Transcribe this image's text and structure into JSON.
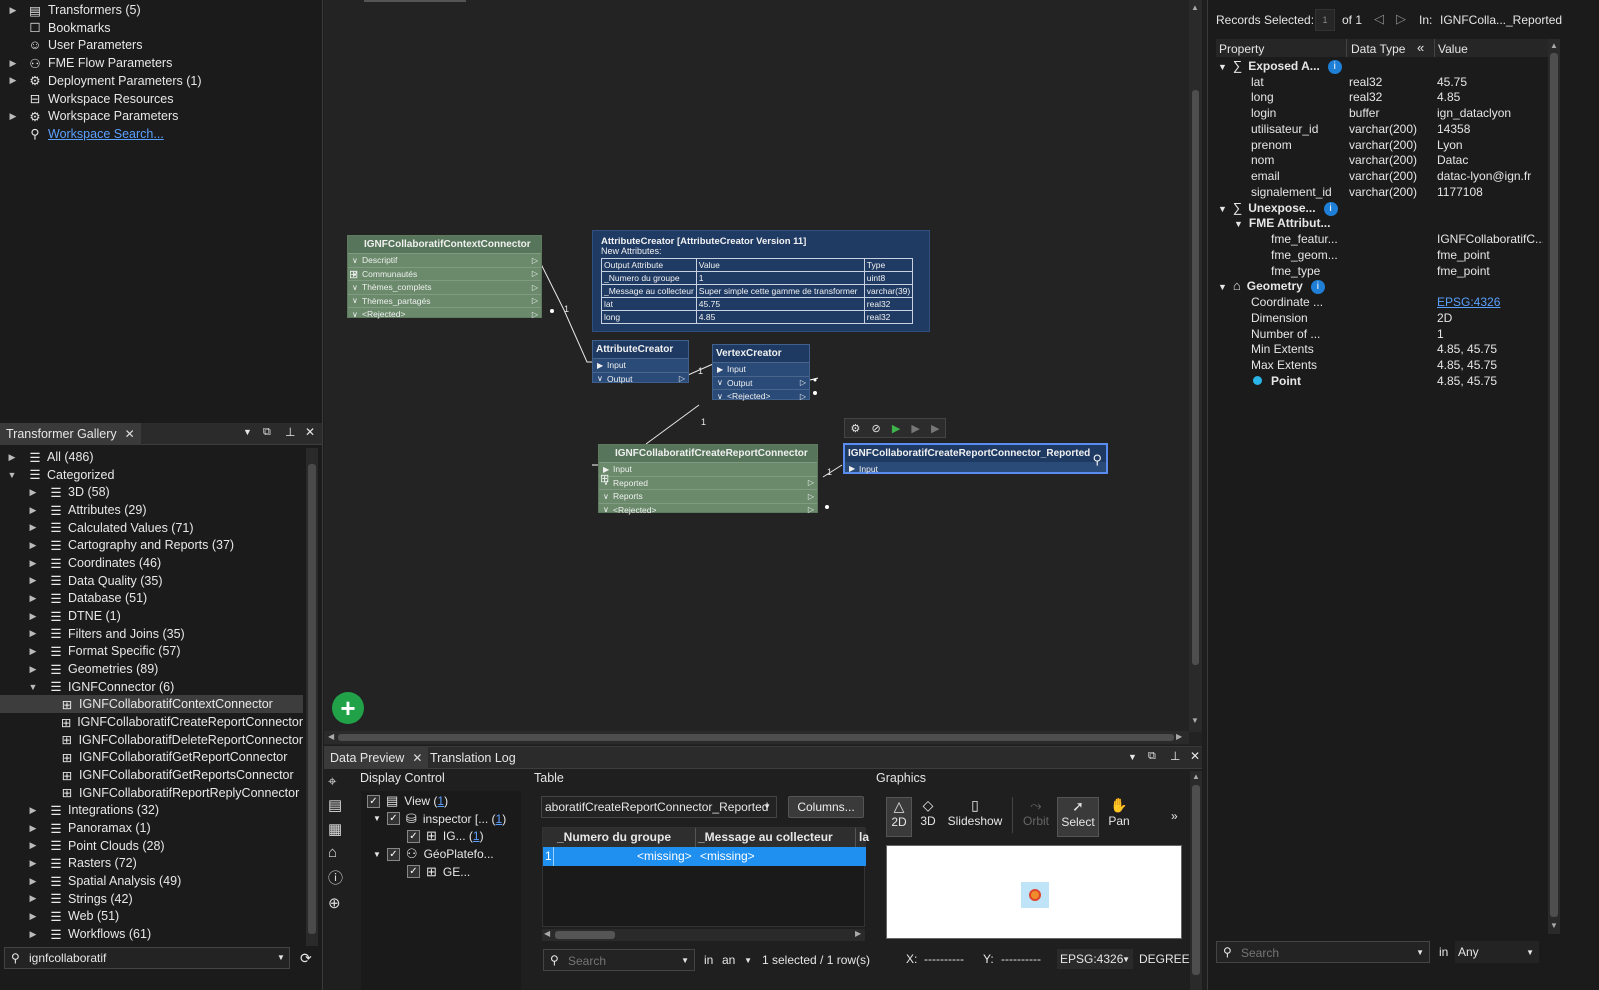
{
  "navigator": {
    "items": [
      {
        "label": "Transformers (5)",
        "expandable": true
      },
      {
        "label": "Bookmarks",
        "expandable": false
      },
      {
        "label": "User Parameters",
        "expandable": false
      },
      {
        "label": "FME Flow Parameters",
        "expandable": true
      },
      {
        "label": "Deployment Parameters (1)",
        "expandable": true
      },
      {
        "label": "Workspace Resources",
        "expandable": false
      },
      {
        "label": "Workspace Parameters",
        "expandable": true
      },
      {
        "label": "Workspace Search...",
        "expandable": false,
        "link": true
      }
    ]
  },
  "gallery": {
    "tab_label": "Transformer Gallery",
    "items": [
      {
        "label": "All (486)",
        "level": 0,
        "state": "collapsed"
      },
      {
        "label": "Categorized",
        "level": 0,
        "state": "expanded"
      },
      {
        "label": "3D (58)",
        "level": 1,
        "state": "collapsed"
      },
      {
        "label": "Attributes (29)",
        "level": 1,
        "state": "collapsed"
      },
      {
        "label": "Calculated Values (71)",
        "level": 1,
        "state": "collapsed"
      },
      {
        "label": "Cartography and Reports (37)",
        "level": 1,
        "state": "collapsed"
      },
      {
        "label": "Coordinates (46)",
        "level": 1,
        "state": "collapsed"
      },
      {
        "label": "Data Quality (35)",
        "level": 1,
        "state": "collapsed"
      },
      {
        "label": "Database (51)",
        "level": 1,
        "state": "collapsed"
      },
      {
        "label": "DTNE (1)",
        "level": 1,
        "state": "collapsed"
      },
      {
        "label": "Filters and Joins (35)",
        "level": 1,
        "state": "collapsed"
      },
      {
        "label": "Format Specific (57)",
        "level": 1,
        "state": "collapsed"
      },
      {
        "label": "Geometries (89)",
        "level": 1,
        "state": "collapsed"
      },
      {
        "label": "IGNFConnector (6)",
        "level": 1,
        "state": "expanded"
      },
      {
        "label": "IGNFCollaboratifContextConnector",
        "level": 2,
        "state": "leaf",
        "selected": true
      },
      {
        "label": "IGNFCollaboratifCreateReportConnector",
        "level": 2,
        "state": "leaf"
      },
      {
        "label": "IGNFCollaboratifDeleteReportConnector",
        "level": 2,
        "state": "leaf"
      },
      {
        "label": "IGNFCollaboratifGetReportConnector",
        "level": 2,
        "state": "leaf"
      },
      {
        "label": "IGNFCollaboratifGetReportsConnector",
        "level": 2,
        "state": "leaf"
      },
      {
        "label": "IGNFCollaboratifReportReplyConnector",
        "level": 2,
        "state": "leaf"
      },
      {
        "label": "Integrations (32)",
        "level": 1,
        "state": "collapsed"
      },
      {
        "label": "Panoramax (1)",
        "level": 1,
        "state": "collapsed"
      },
      {
        "label": "Point Clouds (28)",
        "level": 1,
        "state": "collapsed"
      },
      {
        "label": "Rasters (72)",
        "level": 1,
        "state": "collapsed"
      },
      {
        "label": "Spatial Analysis (49)",
        "level": 1,
        "state": "collapsed"
      },
      {
        "label": "Strings (42)",
        "level": 1,
        "state": "collapsed"
      },
      {
        "label": "Web (51)",
        "level": 1,
        "state": "collapsed"
      },
      {
        "label": "Workflows (61)",
        "level": 1,
        "state": "collapsed"
      }
    ],
    "search_value": "ignfcollaboratif"
  },
  "canvas": {
    "context_node": {
      "title": "IGNFCollaboratifContextConnector",
      "ports": [
        "Descriptif",
        "Communautés",
        "Thèmes_complets",
        "Thèmes_partagés",
        "<Rejected>"
      ]
    },
    "annotation": {
      "title": "AttributeCreator [AttributeCreator Version 11]",
      "subtitle": "New Attributes:",
      "headers": [
        "Output Attribute",
        "Value",
        "Type"
      ],
      "rows": [
        [
          "_Numero du groupe",
          "1",
          "uint8"
        ],
        [
          "_Message au collecteur",
          "Super simple cette gamme de transformer",
          "varchar(39)"
        ],
        [
          "lat",
          "45.75",
          "real32"
        ],
        [
          "long",
          "4.85",
          "real32"
        ]
      ]
    },
    "attribute_creator": {
      "title": "AttributeCreator",
      "ports": [
        "Input",
        "Output"
      ]
    },
    "vertex_creator": {
      "title": "VertexCreator",
      "ports": [
        "Input",
        "Output",
        "<Rejected>"
      ]
    },
    "create_report": {
      "title": "IGNFCollaboratifCreateReportConnector",
      "ports": [
        "Input",
        "Reported",
        "Reports",
        "<Rejected>"
      ]
    },
    "inspector_node": {
      "title": "IGNFCollaboratifCreateReportConnector_Reported",
      "ports": [
        "Input"
      ]
    },
    "link_counts": [
      "1",
      "1",
      "1",
      "1"
    ]
  },
  "inspector": {
    "records_label": "Records Selected:",
    "records_value": "1",
    "records_of": "of 1",
    "in_label": "In:",
    "in_value": "IGNFColla..._Reported",
    "columns": [
      "Property",
      "Data Type",
      "Value"
    ],
    "rows": [
      {
        "indent": 0,
        "group": true,
        "name": "Exposed A...",
        "type": "",
        "value": "",
        "info": true,
        "icon": "sigma"
      },
      {
        "indent": 1,
        "name": "lat",
        "type": "real32",
        "value": "45.75"
      },
      {
        "indent": 1,
        "name": "long",
        "type": "real32",
        "value": "4.85"
      },
      {
        "indent": 1,
        "name": "login",
        "type": "buffer",
        "value": "ign_dataclyon"
      },
      {
        "indent": 1,
        "name": "utilisateur_id",
        "type": "varchar(200)",
        "value": "14358"
      },
      {
        "indent": 1,
        "name": "prenom",
        "type": "varchar(200)",
        "value": "Lyon"
      },
      {
        "indent": 1,
        "name": "nom",
        "type": "varchar(200)",
        "value": "Datac"
      },
      {
        "indent": 1,
        "name": "email",
        "type": "varchar(200)",
        "value": "datac-lyon@ign.fr"
      },
      {
        "indent": 1,
        "name": "signalement_id",
        "type": "varchar(200)",
        "value": "1177108"
      },
      {
        "indent": 0,
        "group": true,
        "name": "Unexpose...",
        "type": "",
        "value": "",
        "info": true,
        "icon": "sigma-x"
      },
      {
        "indent": 1,
        "group": true,
        "name": "FME Attribut...",
        "type": "",
        "value": ""
      },
      {
        "indent": 2,
        "name": "fme_featur...",
        "type": "",
        "value": "IGNFCollaboratifC..."
      },
      {
        "indent": 2,
        "name": "fme_geom...",
        "type": "",
        "value": "fme_point"
      },
      {
        "indent": 2,
        "name": "fme_type",
        "type": "",
        "value": "fme_point"
      },
      {
        "indent": 0,
        "group": true,
        "name": "Geometry",
        "type": "",
        "value": "",
        "info": true,
        "icon": "geometry"
      },
      {
        "indent": 1,
        "name": "Coordinate ...",
        "type": "",
        "value": "EPSG:4326",
        "link": true
      },
      {
        "indent": 1,
        "name": "Dimension",
        "type": "",
        "value": "2D"
      },
      {
        "indent": 1,
        "name": "Number of ...",
        "type": "",
        "value": "1"
      },
      {
        "indent": 1,
        "name": "Min Extents",
        "type": "",
        "value": "4.85, 45.75"
      },
      {
        "indent": 1,
        "name": "Max Extents",
        "type": "",
        "value": "4.85, 45.75"
      },
      {
        "indent": 1,
        "name": "Point",
        "type": "",
        "value": "4.85, 45.75",
        "bold": true,
        "dot": true
      }
    ],
    "search_placeholder": "Search",
    "in_filter_label": "in",
    "in_filter_value": "Any"
  },
  "data_preview": {
    "tabs": [
      "Data Preview",
      "Translation Log"
    ],
    "display_control": {
      "title": "Display Control",
      "items": [
        {
          "label": "View (",
          "count": "1",
          "suffix": ")",
          "level": 0
        },
        {
          "label": "inspector [... (",
          "count": "1",
          "suffix": ")",
          "level": 1
        },
        {
          "label": "IG... (",
          "count": "1",
          "suffix": ")",
          "level": 2
        },
        {
          "label": "GéoPlatefo...",
          "count": "",
          "suffix": "",
          "level": 1
        },
        {
          "label": "GE...",
          "count": "",
          "suffix": "",
          "level": 2
        }
      ]
    },
    "table": {
      "title": "Table",
      "source": "aboratifCreateReportConnector_Reported",
      "columns_button": "Columns...",
      "headers": [
        "_Numero du groupe",
        "_Message au collecteur",
        "la"
      ],
      "row_index": "1",
      "row_values": [
        "<missing>",
        "<missing>"
      ],
      "search_placeholder": "Search",
      "in_label": "in",
      "in_value": "an",
      "status": "1 selected / 1 row(s)"
    },
    "graphics": {
      "title": "Graphics",
      "tools": [
        "2D",
        "3D",
        "Slideshow",
        "Orbit",
        "Select",
        "Pan"
      ],
      "x_label": "X:",
      "x_value": "----------",
      "y_label": "Y:",
      "y_value": "----------",
      "crs": "EPSG:4326",
      "units": "DEGREE"
    }
  }
}
